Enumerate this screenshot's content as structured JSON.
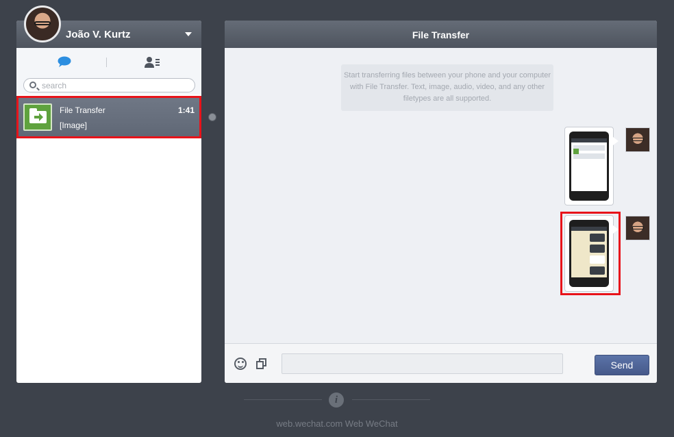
{
  "profile": {
    "name": "João V. Kurtz"
  },
  "search": {
    "placeholder": "search"
  },
  "sessions": [
    {
      "title": "File Transfer",
      "preview": "[Image]",
      "time": "1:41"
    }
  ],
  "chat": {
    "title": "File Transfer",
    "system_notice": "Start transferring files between your phone and your computer with File Transfer. Text, image, audio, video, and any other filetypes are all supported."
  },
  "input": {
    "send_label": "Send"
  },
  "footer": {
    "text": "web.wechat.com  Web WeChat"
  },
  "icons": {
    "chat_tab": "chat-bubble-icon",
    "contacts_tab": "contacts-icon",
    "search": "search-icon",
    "emoji": "emoji-icon",
    "file": "file-icon",
    "info": "info-icon",
    "dropdown": "chevron-down-icon"
  },
  "colors": {
    "accent": "#2c8ee0",
    "send_button": "#4f64a0",
    "highlight": "#e8131a",
    "file_transfer_green": "#5fa23e"
  }
}
